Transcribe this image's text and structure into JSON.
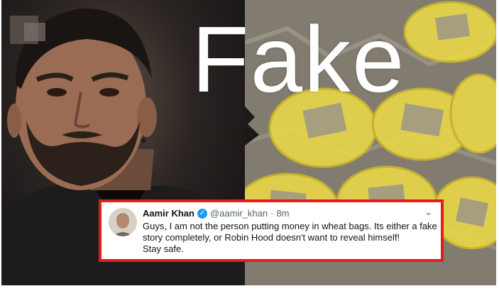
{
  "overlay_text": "Fake",
  "tweet": {
    "author": "Aamir Khan",
    "verified_icon": "verified-badge-icon",
    "handle": "@aamir_khan",
    "separator": "·",
    "time": "8m",
    "menu_icon": "chevron-down-icon",
    "lines": [
      "Guys, I am not the person putting money in wheat bags. Its either a fake",
      "story completely, or Robin Hood doesn't want to reveal himself!",
      "Stay safe."
    ]
  },
  "colors": {
    "highlight_border": "#e31c1c",
    "verified_blue": "#1d9bf0",
    "wrap_yellow": "#e8d64a"
  }
}
